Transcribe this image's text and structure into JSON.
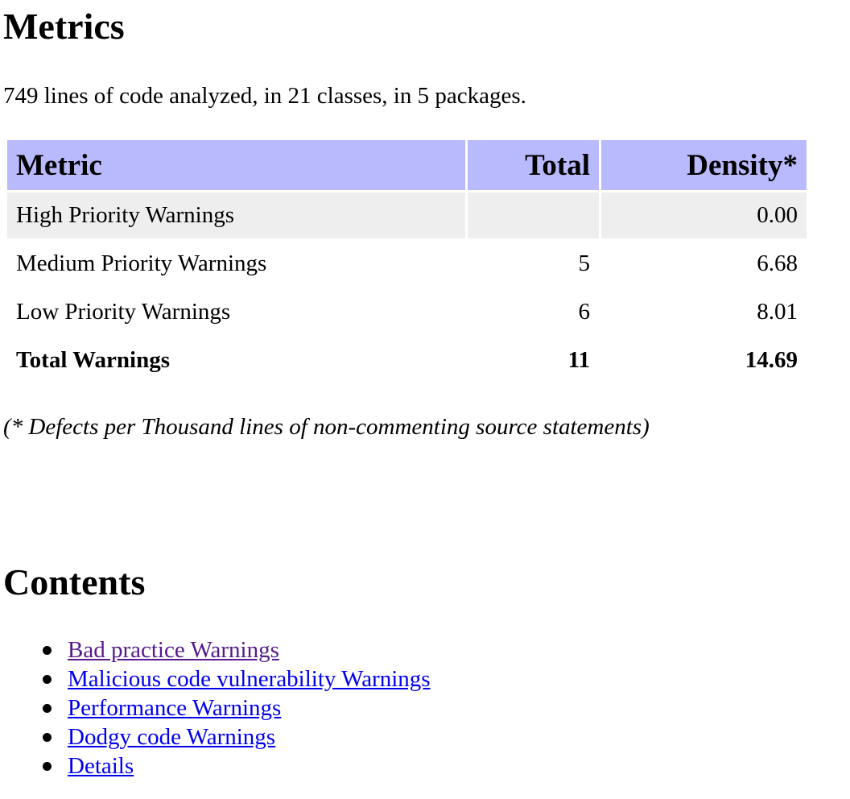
{
  "metrics": {
    "heading": "Metrics",
    "summary": "749 lines of code analyzed, in 21 classes, in 5 packages.",
    "table": {
      "headers": {
        "metric": "Metric",
        "total": "Total",
        "density": "Density*"
      },
      "rows": [
        {
          "metric": "High Priority Warnings",
          "total": "",
          "density": "0.00"
        },
        {
          "metric": "Medium Priority Warnings",
          "total": "5",
          "density": "6.68"
        },
        {
          "metric": "Low Priority Warnings",
          "total": "6",
          "density": "8.01"
        },
        {
          "metric": "Total Warnings",
          "total": "11",
          "density": "14.69"
        }
      ]
    },
    "footnote": "(* Defects per Thousand lines of non-commenting source statements)"
  },
  "contents": {
    "heading": "Contents",
    "items": [
      {
        "label": "Bad practice Warnings",
        "visited": true
      },
      {
        "label": "Malicious code vulnerability Warnings",
        "visited": false
      },
      {
        "label": "Performance Warnings",
        "visited": false
      },
      {
        "label": "Dodgy code Warnings",
        "visited": false
      },
      {
        "label": "Details",
        "visited": false
      }
    ]
  },
  "colors": {
    "header_bg": "#b9b9fe",
    "stripe_bg": "#eeeeee",
    "link": "#0000ee",
    "link_visited": "#551a8b"
  }
}
